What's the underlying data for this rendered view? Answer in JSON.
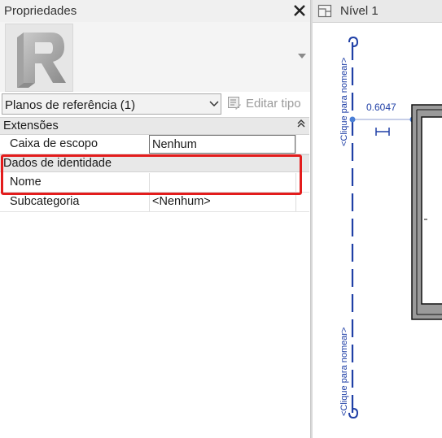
{
  "properties": {
    "title": "Propriedades",
    "selector_label": "Planos de referência (1)",
    "edit_type_label": "Editar tipo",
    "groups": [
      {
        "label": "Extensões"
      },
      {
        "label": "Dados de identidade"
      }
    ],
    "rows": [
      {
        "name": "Caixa de escopo",
        "value": "Nenhum"
      },
      {
        "name": "Nome",
        "value": ""
      },
      {
        "name": "Subcategoria",
        "value": "<Nenhum>"
      }
    ]
  },
  "view": {
    "tab_title": "Nível 1",
    "ref_plane_label_top": "<Clique para nomear>",
    "ref_plane_label_bottom": "<Clique para nomear>",
    "dimension_value": "0.6047"
  },
  "colors": {
    "highlight": "#e31c1c",
    "annotation_blue": "#1f3fa6"
  },
  "icons": [
    "revit-logo-icon",
    "close-icon",
    "chevron-down-icon",
    "edit-type-icon",
    "collapse-icon",
    "floor-plan-view-icon",
    "dimension-lock-icon"
  ]
}
